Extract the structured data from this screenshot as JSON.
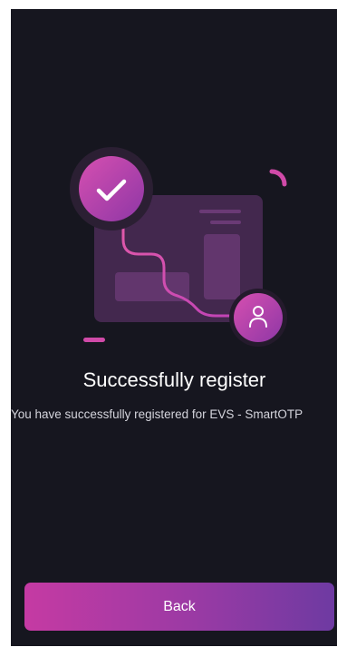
{
  "success": {
    "title": "Successfully register",
    "description": "You have successfully registered for EVS - SmartOTP"
  },
  "illustration": {
    "icons": [
      "check-icon",
      "user-icon"
    ]
  },
  "actions": {
    "back_label": "Back"
  },
  "colors": {
    "background": "#16161f",
    "accent_pink": "#c53aa3",
    "accent_purple": "#6e3aa2"
  }
}
